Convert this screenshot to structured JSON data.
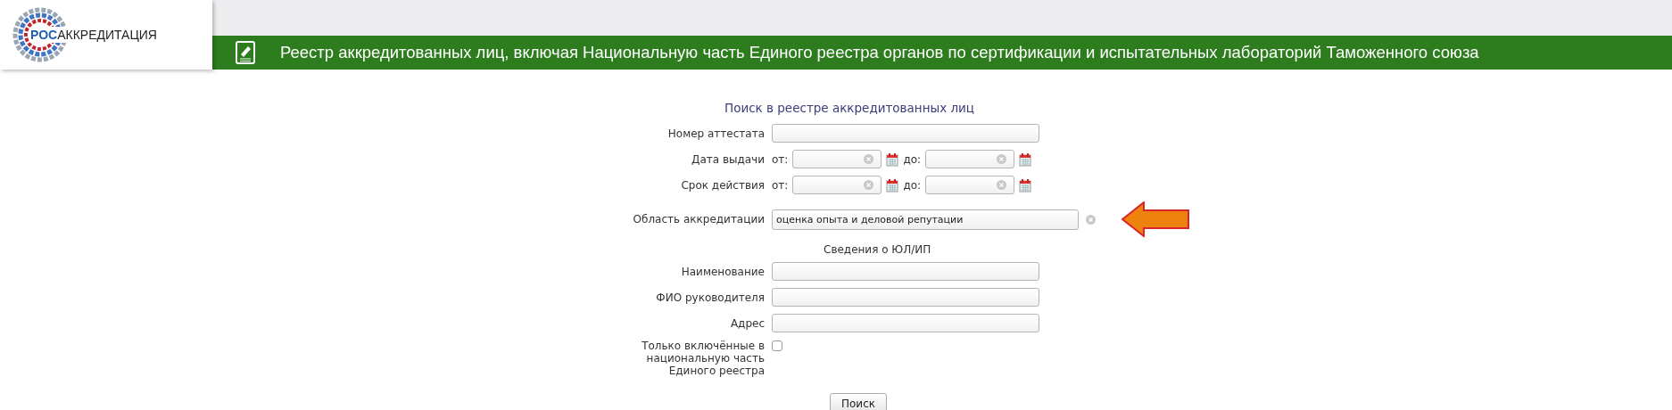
{
  "header": {
    "logo_text_a": "РОС",
    "logo_text_b": "АККРЕДИТАЦИЯ",
    "title": "Реестр аккредитованных лиц, включая Национальную часть Единого реестра органов по сертификации и испытательных лабораторий Таможенного союза"
  },
  "form": {
    "title": "Поиск в реестре аккредитованных лиц",
    "rows": [
      {
        "kind": "text",
        "label": "Номер аттестата"
      },
      {
        "kind": "daterange",
        "label": "Дата выдачи",
        "from_label": "от:",
        "to_label": "до:"
      },
      {
        "kind": "daterange",
        "label": "Срок действия",
        "from_label": "от:",
        "to_label": "до:"
      },
      {
        "kind": "clearable",
        "label": "Область аккредитации",
        "value": "оценка опыта и деловой репутации"
      },
      {
        "kind": "section",
        "label": "Сведения о ЮЛ/ИП"
      },
      {
        "kind": "text",
        "label": "Наименование"
      },
      {
        "kind": "text",
        "label": "ФИО руководителя"
      },
      {
        "kind": "text",
        "label": "Адрес"
      },
      {
        "kind": "checkbox",
        "label": "Только включённые в национальную часть Единого реестра",
        "checked": false
      }
    ],
    "submit": "Поиск"
  }
}
